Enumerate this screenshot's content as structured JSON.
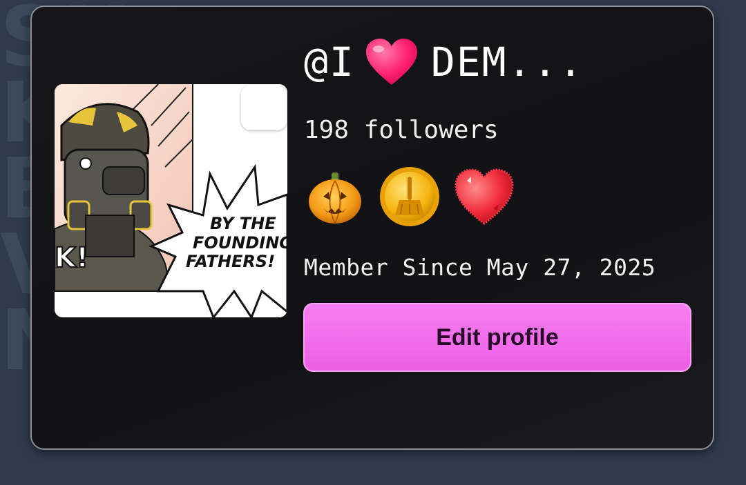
{
  "profile": {
    "username_prefix": "@I",
    "username_suffix": "DEM...",
    "followers": "198 followers",
    "member_since": "Member Since May 27, 2025",
    "edit_button_label": "Edit profile"
  },
  "avatar": {
    "comic_text": [
      "BY THE",
      "FOUNDING",
      "FATHERS!"
    ],
    "side_text": "K!"
  },
  "badges": [
    {
      "icon": "pumpkin-badge-icon"
    },
    {
      "icon": "broom-coin-badge-icon"
    },
    {
      "icon": "heart-badge-icon"
    }
  ],
  "background_text": [
    "SH",
    "KI",
    "BA",
    "VV",
    "NK"
  ],
  "colors": {
    "accent_pink": "#f06ae9",
    "card_bg": "#141416",
    "page_bg": "#2f3b4d"
  }
}
